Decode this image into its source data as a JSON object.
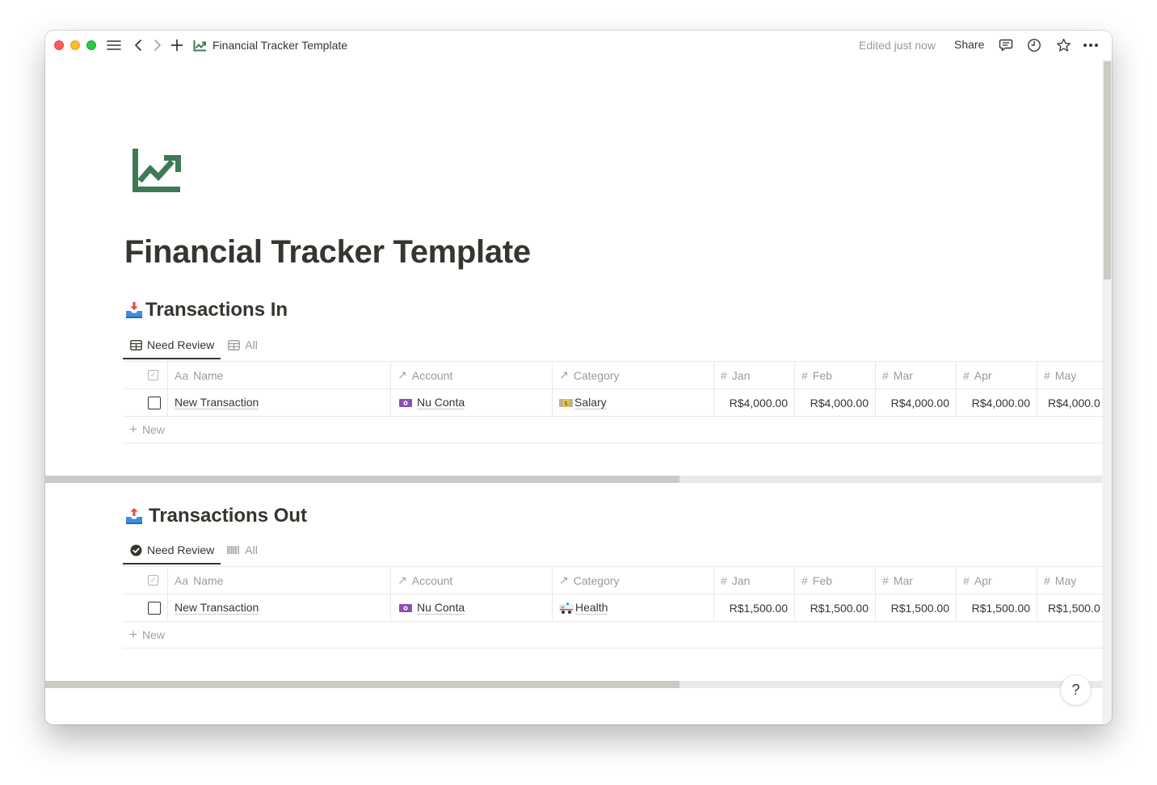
{
  "window": {
    "title": "Financial Tracker Template",
    "edited_status": "Edited just now",
    "share_label": "Share",
    "icons": [
      "sidebar-menu-icon",
      "back-icon",
      "forward-icon",
      "new-page-icon",
      "chart-line-up-icon",
      "comments-icon",
      "history-clock-icon",
      "favorite-star-icon",
      "more-dots-icon"
    ]
  },
  "page": {
    "icon": "chart-line-up-icon",
    "icon_color": "#3d7a55",
    "title": "Financial Tracker Template"
  },
  "sections": [
    {
      "id": "in",
      "emoji": "inbox-tray",
      "title": "Transactions In",
      "tabs": [
        {
          "label": "Need Review",
          "icon": "table-icon",
          "active": true
        },
        {
          "label": "All",
          "icon": "table-icon",
          "active": false
        }
      ],
      "columns": [
        {
          "icon": "checkbox-icon",
          "label": ""
        },
        {
          "icon": "Aa",
          "label": "Name"
        },
        {
          "icon": "↗",
          "label": "Account"
        },
        {
          "icon": "↗",
          "label": "Category"
        },
        {
          "icon": "#",
          "label": "Jan"
        },
        {
          "icon": "#",
          "label": "Feb"
        },
        {
          "icon": "#",
          "label": "Mar"
        },
        {
          "icon": "#",
          "label": "Apr"
        },
        {
          "icon": "#",
          "label": "May"
        }
      ],
      "rows": [
        {
          "checked": false,
          "name": "New Transaction",
          "account": "Nu Conta",
          "account_emoji": "banknote-purple",
          "category": "Salary",
          "category_emoji": "dollar-banknote",
          "months": [
            "R$4,000.00",
            "R$4,000.00",
            "R$4,000.00",
            "R$4,000.00",
            "R$4,000.0"
          ]
        }
      ],
      "new_label": "New",
      "scroll_fraction": 0.6
    },
    {
      "id": "out",
      "emoji": "outbox-tray",
      "title": "Transactions Out",
      "tabs": [
        {
          "label": "Need Review",
          "icon": "check-circle-icon",
          "active": true
        },
        {
          "label": "All",
          "icon": "barcode-icon",
          "active": false
        }
      ],
      "columns": [
        {
          "icon": "checkbox-icon",
          "label": ""
        },
        {
          "icon": "Aa",
          "label": "Name"
        },
        {
          "icon": "↗",
          "label": "Account"
        },
        {
          "icon": "↗",
          "label": "Category"
        },
        {
          "icon": "#",
          "label": "Jan"
        },
        {
          "icon": "#",
          "label": "Feb"
        },
        {
          "icon": "#",
          "label": "Mar"
        },
        {
          "icon": "#",
          "label": "Apr"
        },
        {
          "icon": "#",
          "label": "May"
        }
      ],
      "rows": [
        {
          "checked": false,
          "name": "New Transaction",
          "account": "Nu Conta",
          "account_emoji": "banknote-purple",
          "category": "Health",
          "category_emoji": "ambulance",
          "months": [
            "R$1,500.00",
            "R$1,500.00",
            "R$1,500.00",
            "R$1,500.00",
            "R$1,500.0"
          ]
        }
      ],
      "new_label": "New",
      "scroll_fraction": 0.6
    }
  ],
  "help_label": "?"
}
